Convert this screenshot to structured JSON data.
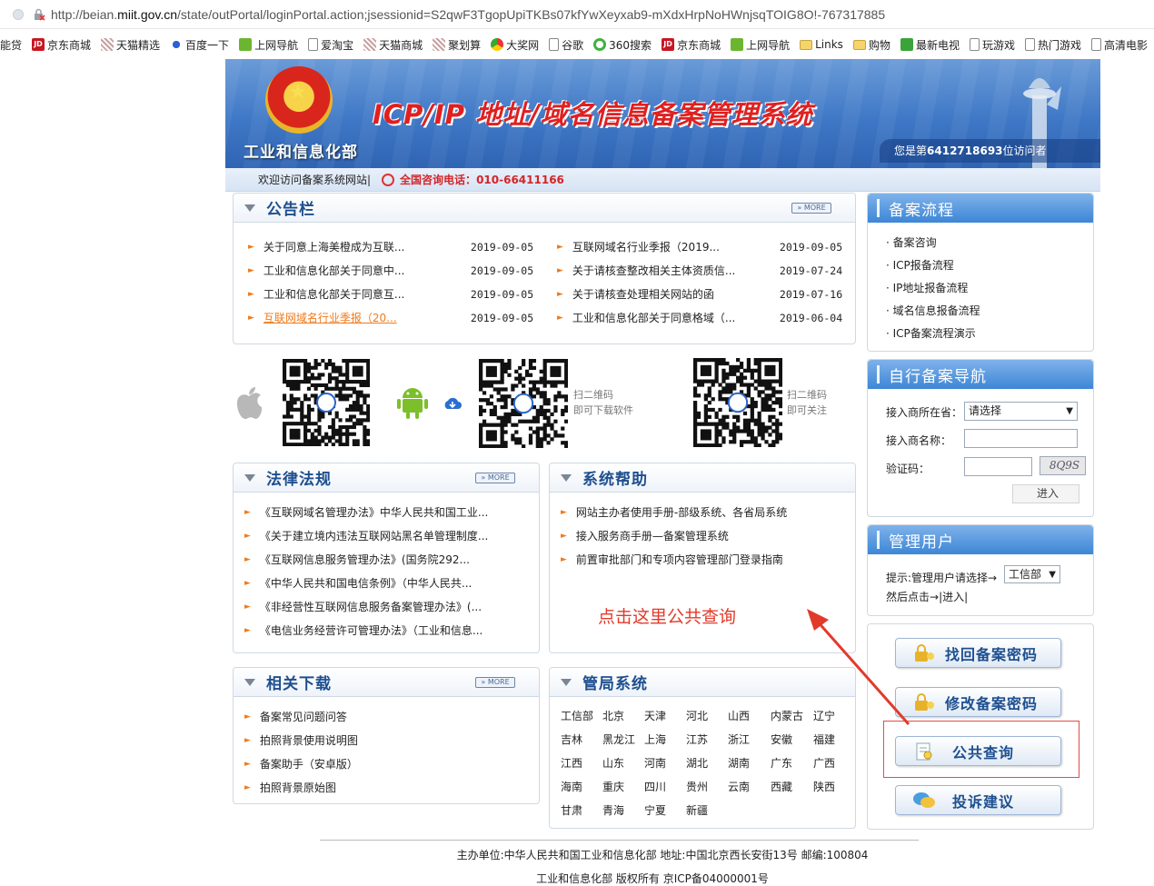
{
  "browser": {
    "url_prefix": "http://beian.",
    "url_domain": "miit.gov.cn",
    "url_rest": "/state/outPortal/loginPortal.action;jsessionid=S2qwF3TgopUpiTKBs07kfYwXeyxab9-mXdxHrpNoHWnjsqTOIG8O!-767317885",
    "bookmarks": [
      "能贷",
      "京东商城",
      "天猫精选",
      "百度一下",
      "上网导航",
      "爱淘宝",
      "天猫商城",
      "聚划算",
      "大奖网",
      "谷歌",
      "360搜索",
      "京东商城",
      "上网导航",
      "Links",
      "购物",
      "最新电视",
      "玩游戏",
      "热门游戏",
      "高清电影"
    ]
  },
  "header": {
    "ministry": "工业和信息化部",
    "system_title": "ICP/IP 地址/域名信息备案管理系统",
    "visitor_prefix": "您是第",
    "visitor_count": "6412718693",
    "visitor_suffix": "位访问者",
    "welcome": "欢迎访问备案系统网站|",
    "hotline_label": "全国咨询电话：",
    "hotline_number": "010-66411166"
  },
  "notice": {
    "title": "公告栏",
    "more": "» MORE",
    "left": [
      {
        "title": "关于同意上海美橙成为互联...",
        "date": "2019-09-05"
      },
      {
        "title": "工业和信息化部关于同意中...",
        "date": "2019-09-05"
      },
      {
        "title": "工业和信息化部关于同意互...",
        "date": "2019-09-05"
      },
      {
        "title": "互联网域名行业季报（20...",
        "date": "2019-09-05"
      }
    ],
    "right": [
      {
        "title": "互联网域名行业季报（2019...",
        "date": "2019-09-05"
      },
      {
        "title": "关于请核查整改相关主体资质信...",
        "date": "2019-07-24"
      },
      {
        "title": "关于请核查处理相关网站的函",
        "date": "2019-07-16"
      },
      {
        "title": "工业和信息化部关于同意格域（...",
        "date": "2019-06-04"
      }
    ]
  },
  "apps": {
    "scan_download_1": "扫二维码",
    "scan_download_2": "即可下载软件",
    "scan_follow_1": "扫二维码",
    "scan_follow_2": "即可关注"
  },
  "laws": {
    "title": "法律法规",
    "more": "» MORE",
    "items": [
      "《互联网域名管理办法》中华人民共和国工业...",
      "《关于建立境内违法互联网站黑名单管理制度...",
      "《互联网信息服务管理办法》(国务院292...",
      "《中华人民共和国电信条例》（中华人民共...",
      "《非经营性互联网信息服务备案管理办法》(...",
      "《电信业务经营许可管理办法》（工业和信息..."
    ]
  },
  "help": {
    "title": "系统帮助",
    "items": [
      "网站主办者使用手册-部级系统、各省局系统",
      "接入服务商手册—备案管理系统",
      "前置审批部门和专项内容管理部门登录指南"
    ]
  },
  "downloads": {
    "title": "相关下载",
    "more": "» MORE",
    "items": [
      "备案常见问题问答",
      "拍照背景使用说明图",
      "备案助手（安卓版）",
      "拍照背景原始图"
    ]
  },
  "bureaus": {
    "title": "管局系统",
    "rows": [
      [
        "工信部",
        "北京",
        "天津",
        "河北",
        "山西",
        "内蒙古",
        "辽宁"
      ],
      [
        "吉林",
        "黑龙江",
        "上海",
        "江苏",
        "浙江",
        "安徽",
        "福建"
      ],
      [
        "江西",
        "山东",
        "河南",
        "湖北",
        "湖南",
        "广东",
        "广西"
      ],
      [
        "海南",
        "重庆",
        "四川",
        "贵州",
        "云南",
        "西藏",
        "陕西"
      ],
      [
        "甘肃",
        "青海",
        "宁夏",
        "新疆"
      ]
    ]
  },
  "process": {
    "title": "备案流程",
    "items": [
      "备案咨询",
      "ICP报备流程",
      "IP地址报备流程",
      "域名信息报备流程",
      "ICP备案流程演示"
    ]
  },
  "nav": {
    "title": "自行备案导航",
    "location_label": "接入商所在省：",
    "location_value": "请选择",
    "name_label": "接入商名称：",
    "name_value": "",
    "code_label": "验证码：",
    "code_value": "",
    "captcha": "8Q9S",
    "enter": "进入"
  },
  "admin": {
    "title": "管理用户",
    "hint": "提示:管理用户请选择→",
    "select_value": "工信部",
    "then": "然后点击→",
    "enter": "|进入|"
  },
  "actions": {
    "recover": "找回备案密码",
    "modify": "修改备案密码",
    "query": "公共查询",
    "complaint": "投诉建议"
  },
  "annotation": "点击这里公共查询",
  "footer": {
    "line1": "主办单位:中华人民共和国工业和信息化部 地址:中国北京西长安街13号 邮编:100804",
    "line2": "工业和信息化部 版权所有 京ICP备04000001号"
  },
  "colors": {
    "accent": "#1e4f8f",
    "orange": "#f07a1a",
    "red": "#d2262a",
    "annotation": "#e23a2a"
  }
}
